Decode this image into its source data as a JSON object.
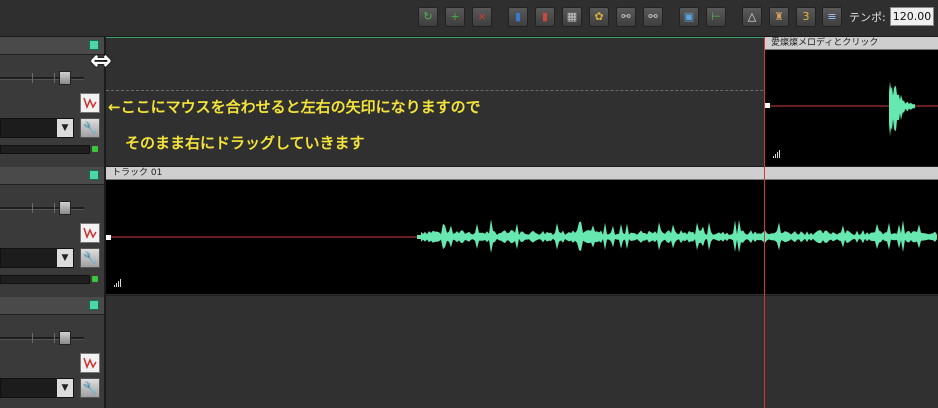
{
  "toolbar": {
    "buttons": [
      {
        "name": "loop-icon",
        "glyph": "↻",
        "color": "#4fb34f"
      },
      {
        "name": "add-track-icon",
        "glyph": "+",
        "color": "#3fae3f"
      },
      {
        "name": "delete-track-icon",
        "glyph": "×",
        "color": "#d43b2e"
      },
      {
        "name": "mixer-icon",
        "glyph": "▮",
        "color": "#3a78c9"
      },
      {
        "name": "mixer-alt-icon",
        "glyph": "▮",
        "color": "#c94a3a"
      },
      {
        "name": "keyboard-icon",
        "glyph": "▦",
        "color": "#c9c9c9"
      },
      {
        "name": "effect-icon",
        "glyph": "✿",
        "color": "#d2b13c"
      },
      {
        "name": "link-icon",
        "glyph": "⚯",
        "color": "#cfcfcf"
      },
      {
        "name": "unlink-icon",
        "glyph": "⚯",
        "color": "#cfcfcf"
      },
      {
        "name": "snapshot-icon",
        "glyph": "▣",
        "color": "#5aa6e0"
      },
      {
        "name": "marker-icon",
        "glyph": "⊢",
        "color": "#4fb34f"
      },
      {
        "name": "metronome-icon",
        "glyph": "△",
        "color": "#e6e6e6"
      },
      {
        "name": "record-device-icon",
        "glyph": "♜",
        "color": "#d0a060"
      },
      {
        "name": "count-in-icon",
        "glyph": "3",
        "color": "#e8b830"
      },
      {
        "name": "tempo-icon",
        "glyph": "≡",
        "color": "#a0c0ff"
      }
    ],
    "tempo_label": "テンポ:",
    "tempo_value": "120.00"
  },
  "annotation": {
    "line1": "←ここにマウスを合わせると左右の矢印になりますので",
    "line2": "そのまま右にドラッグしていきます"
  },
  "clips": {
    "top_title": "愛燦燦メロディとクリック",
    "track01_title": "トラック 01"
  },
  "colors": {
    "waveform": "#66e8b0",
    "accent_square": "#4fd6a8",
    "annotation": "#f4e33a",
    "playhead": "#d23a3a"
  }
}
